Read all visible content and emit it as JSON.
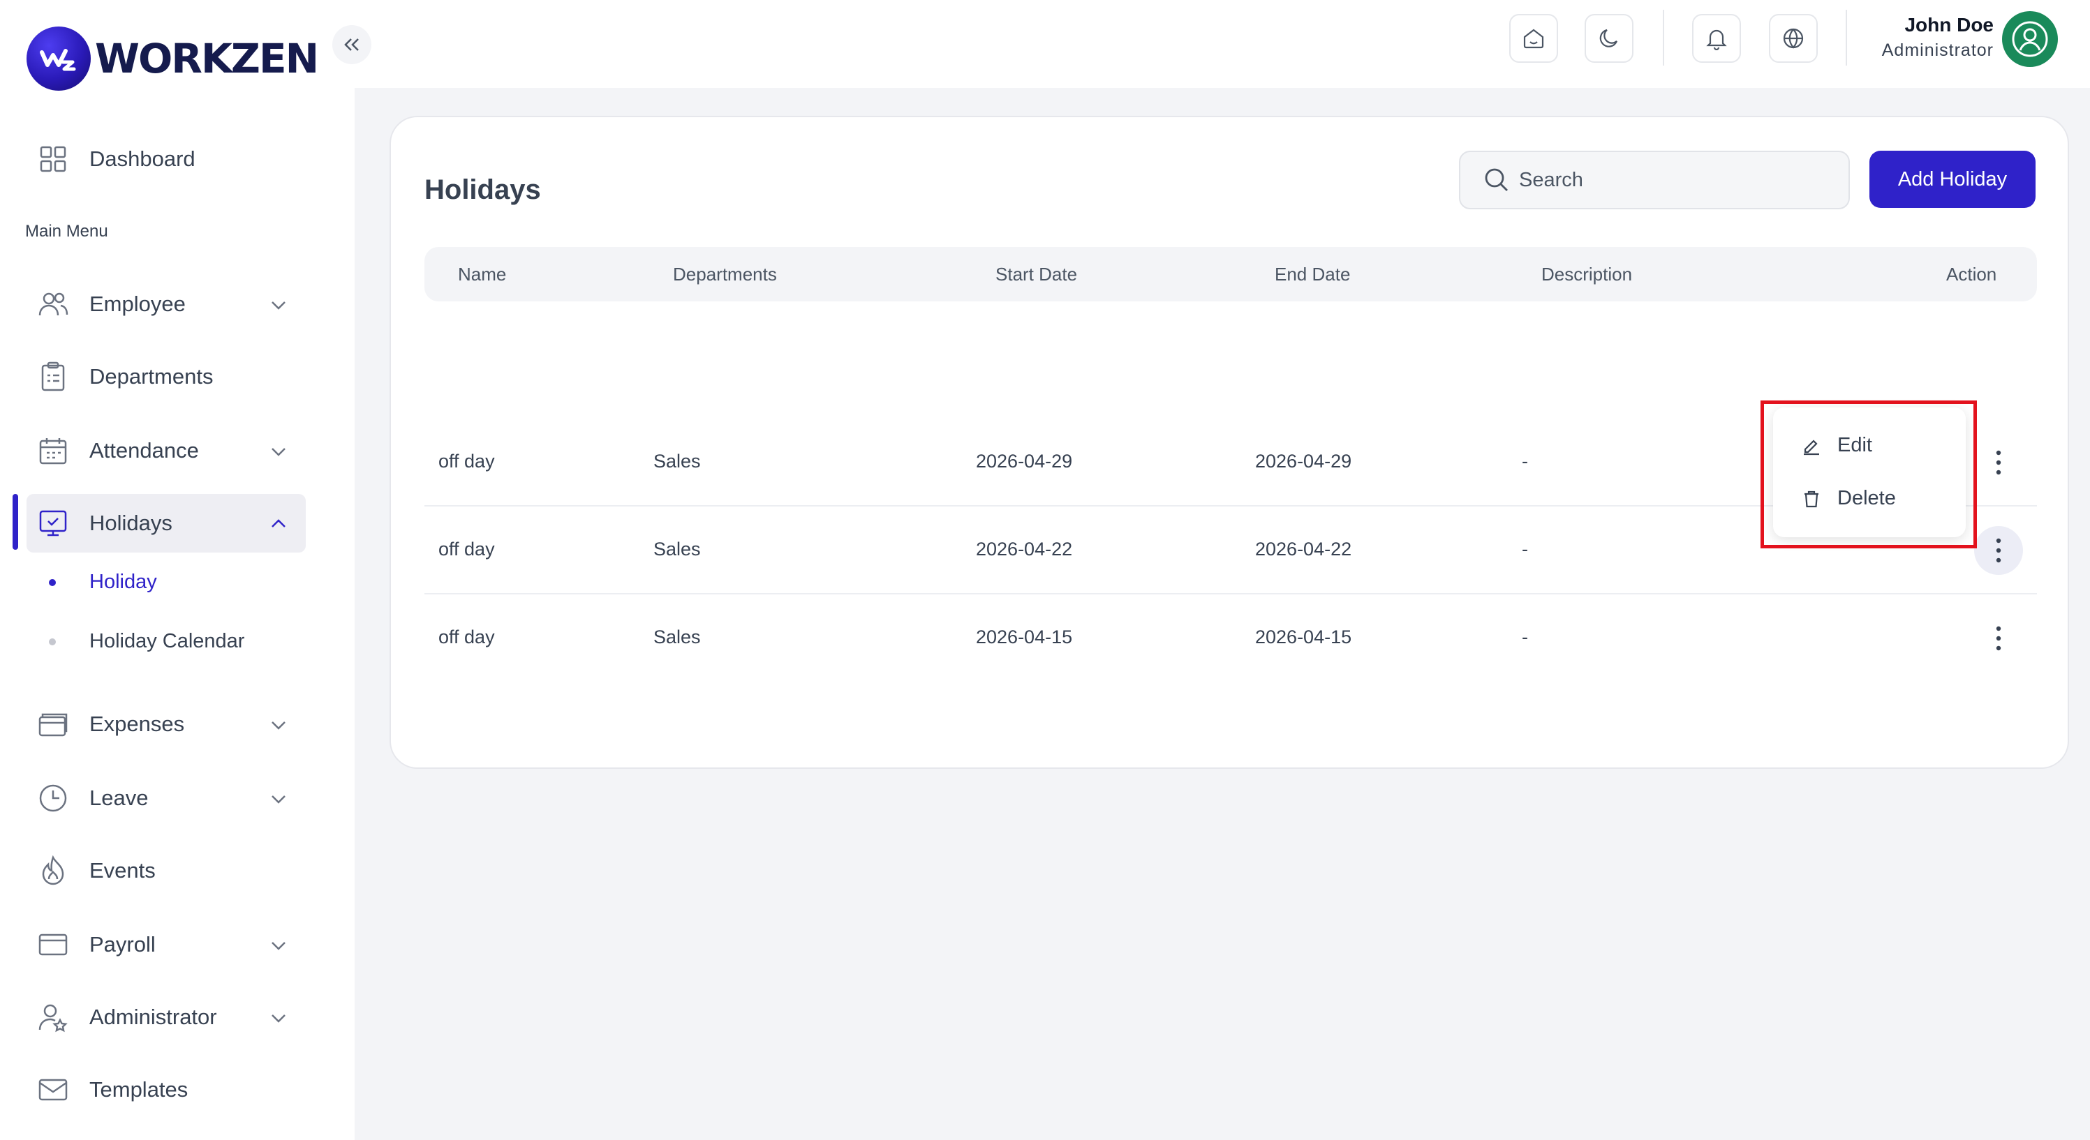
{
  "brand": {
    "name": "WORKZEN"
  },
  "sidebar": {
    "dashboard_label": "Dashboard",
    "section_label": "Main Menu",
    "items": [
      {
        "label": "Employee"
      },
      {
        "label": "Departments"
      },
      {
        "label": "Attendance"
      },
      {
        "label": "Holidays"
      },
      {
        "label": "Expenses"
      },
      {
        "label": "Leave"
      },
      {
        "label": "Events"
      },
      {
        "label": "Payroll"
      },
      {
        "label": "Administrator"
      },
      {
        "label": "Templates"
      }
    ],
    "sub_items": [
      {
        "label": "Holiday"
      },
      {
        "label": "Holiday Calendar"
      }
    ]
  },
  "header": {
    "user_name": "John Doe",
    "user_role": "Administrator"
  },
  "page": {
    "title": "Holidays",
    "search_placeholder": "Search",
    "add_button": "Add Holiday"
  },
  "table": {
    "columns": [
      "Name",
      "Departments",
      "Start Date",
      "End Date",
      "Description",
      "Action"
    ],
    "rows": [
      {
        "name": "off day",
        "department": "Sales",
        "start": "2026-04-29",
        "end": "2026-04-29",
        "description": "-"
      },
      {
        "name": "off day",
        "department": "Sales",
        "start": "2026-04-22",
        "end": "2026-04-22",
        "description": "-"
      },
      {
        "name": "off day",
        "department": "Sales",
        "start": "2026-04-15",
        "end": "2026-04-15",
        "description": "-"
      }
    ]
  },
  "action_menu": {
    "edit_label": "Edit",
    "delete_label": "Delete"
  },
  "colors": {
    "accent": "#2f22c9",
    "avatar": "#1a8a5a",
    "highlight": "#e3121d"
  }
}
